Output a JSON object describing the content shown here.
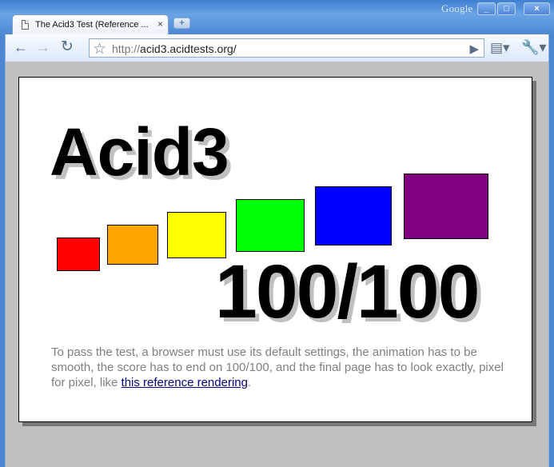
{
  "titlebar": {
    "brand": "Google",
    "minimize_icon": "minimize-icon",
    "maximize_icon": "maximize-icon",
    "close_icon": "close-icon"
  },
  "tab": {
    "title": "The Acid3 Test (Reference ...",
    "favicon": "page-icon",
    "close_glyph": "×",
    "new_tab_glyph": "+"
  },
  "toolbar": {
    "back_glyph": "←",
    "forward_glyph": "→",
    "reload_glyph": "↻",
    "star_glyph": "☆",
    "url_scheme": "http://",
    "url_rest": "acid3.acidtests.org/",
    "go_glyph": "▶",
    "page_menu_glyph": "▤▾",
    "tools_menu_glyph": "🔧▾"
  },
  "page": {
    "headline": "Acid3",
    "score": "100/100",
    "description_prefix": "To pass the test, a browser must use its default settings, the animation has to be smooth, the score has to end on 100/100, and the final page has to look exactly, pixel for pixel, like ",
    "link_text": "this reference rendering",
    "description_suffix": "."
  },
  "boxes": [
    {
      "name": "red-box",
      "color": "#ff0000"
    },
    {
      "name": "orange-box",
      "color": "#ffa500"
    },
    {
      "name": "yellow-box",
      "color": "#ffff00"
    },
    {
      "name": "lime-box",
      "color": "#00ff00"
    },
    {
      "name": "blue-box",
      "color": "#0000ff"
    },
    {
      "name": "purple-box",
      "color": "#800080"
    }
  ]
}
